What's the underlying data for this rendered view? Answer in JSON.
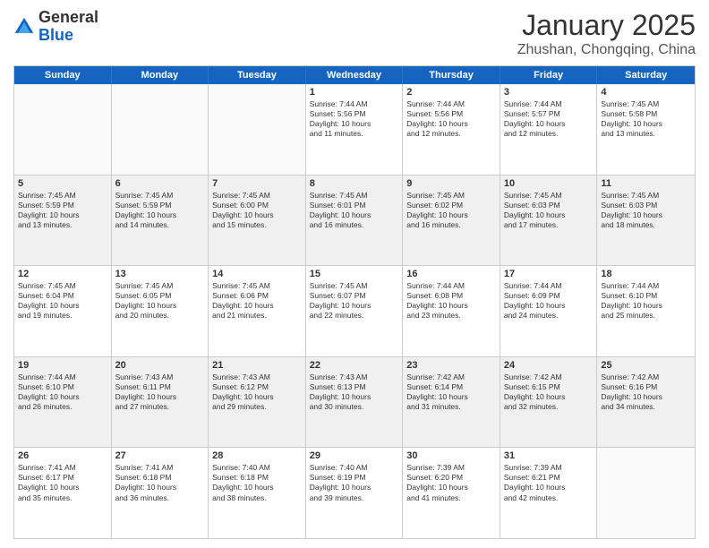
{
  "logo": {
    "general": "General",
    "blue": "Blue"
  },
  "header": {
    "title": "January 2025",
    "subtitle": "Zhushan, Chongqing, China"
  },
  "weekdays": [
    "Sunday",
    "Monday",
    "Tuesday",
    "Wednesday",
    "Thursday",
    "Friday",
    "Saturday"
  ],
  "weeks": [
    [
      {
        "day": "",
        "lines": []
      },
      {
        "day": "",
        "lines": []
      },
      {
        "day": "",
        "lines": []
      },
      {
        "day": "1",
        "lines": [
          "Sunrise: 7:44 AM",
          "Sunset: 5:56 PM",
          "Daylight: 10 hours",
          "and 11 minutes."
        ]
      },
      {
        "day": "2",
        "lines": [
          "Sunrise: 7:44 AM",
          "Sunset: 5:56 PM",
          "Daylight: 10 hours",
          "and 12 minutes."
        ]
      },
      {
        "day": "3",
        "lines": [
          "Sunrise: 7:44 AM",
          "Sunset: 5:57 PM",
          "Daylight: 10 hours",
          "and 12 minutes."
        ]
      },
      {
        "day": "4",
        "lines": [
          "Sunrise: 7:45 AM",
          "Sunset: 5:58 PM",
          "Daylight: 10 hours",
          "and 13 minutes."
        ]
      }
    ],
    [
      {
        "day": "5",
        "lines": [
          "Sunrise: 7:45 AM",
          "Sunset: 5:59 PM",
          "Daylight: 10 hours",
          "and 13 minutes."
        ]
      },
      {
        "day": "6",
        "lines": [
          "Sunrise: 7:45 AM",
          "Sunset: 5:59 PM",
          "Daylight: 10 hours",
          "and 14 minutes."
        ]
      },
      {
        "day": "7",
        "lines": [
          "Sunrise: 7:45 AM",
          "Sunset: 6:00 PM",
          "Daylight: 10 hours",
          "and 15 minutes."
        ]
      },
      {
        "day": "8",
        "lines": [
          "Sunrise: 7:45 AM",
          "Sunset: 6:01 PM",
          "Daylight: 10 hours",
          "and 16 minutes."
        ]
      },
      {
        "day": "9",
        "lines": [
          "Sunrise: 7:45 AM",
          "Sunset: 6:02 PM",
          "Daylight: 10 hours",
          "and 16 minutes."
        ]
      },
      {
        "day": "10",
        "lines": [
          "Sunrise: 7:45 AM",
          "Sunset: 6:03 PM",
          "Daylight: 10 hours",
          "and 17 minutes."
        ]
      },
      {
        "day": "11",
        "lines": [
          "Sunrise: 7:45 AM",
          "Sunset: 6:03 PM",
          "Daylight: 10 hours",
          "and 18 minutes."
        ]
      }
    ],
    [
      {
        "day": "12",
        "lines": [
          "Sunrise: 7:45 AM",
          "Sunset: 6:04 PM",
          "Daylight: 10 hours",
          "and 19 minutes."
        ]
      },
      {
        "day": "13",
        "lines": [
          "Sunrise: 7:45 AM",
          "Sunset: 6:05 PM",
          "Daylight: 10 hours",
          "and 20 minutes."
        ]
      },
      {
        "day": "14",
        "lines": [
          "Sunrise: 7:45 AM",
          "Sunset: 6:06 PM",
          "Daylight: 10 hours",
          "and 21 minutes."
        ]
      },
      {
        "day": "15",
        "lines": [
          "Sunrise: 7:45 AM",
          "Sunset: 6:07 PM",
          "Daylight: 10 hours",
          "and 22 minutes."
        ]
      },
      {
        "day": "16",
        "lines": [
          "Sunrise: 7:44 AM",
          "Sunset: 6:08 PM",
          "Daylight: 10 hours",
          "and 23 minutes."
        ]
      },
      {
        "day": "17",
        "lines": [
          "Sunrise: 7:44 AM",
          "Sunset: 6:09 PM",
          "Daylight: 10 hours",
          "and 24 minutes."
        ]
      },
      {
        "day": "18",
        "lines": [
          "Sunrise: 7:44 AM",
          "Sunset: 6:10 PM",
          "Daylight: 10 hours",
          "and 25 minutes."
        ]
      }
    ],
    [
      {
        "day": "19",
        "lines": [
          "Sunrise: 7:44 AM",
          "Sunset: 6:10 PM",
          "Daylight: 10 hours",
          "and 26 minutes."
        ]
      },
      {
        "day": "20",
        "lines": [
          "Sunrise: 7:43 AM",
          "Sunset: 6:11 PM",
          "Daylight: 10 hours",
          "and 27 minutes."
        ]
      },
      {
        "day": "21",
        "lines": [
          "Sunrise: 7:43 AM",
          "Sunset: 6:12 PM",
          "Daylight: 10 hours",
          "and 29 minutes."
        ]
      },
      {
        "day": "22",
        "lines": [
          "Sunrise: 7:43 AM",
          "Sunset: 6:13 PM",
          "Daylight: 10 hours",
          "and 30 minutes."
        ]
      },
      {
        "day": "23",
        "lines": [
          "Sunrise: 7:42 AM",
          "Sunset: 6:14 PM",
          "Daylight: 10 hours",
          "and 31 minutes."
        ]
      },
      {
        "day": "24",
        "lines": [
          "Sunrise: 7:42 AM",
          "Sunset: 6:15 PM",
          "Daylight: 10 hours",
          "and 32 minutes."
        ]
      },
      {
        "day": "25",
        "lines": [
          "Sunrise: 7:42 AM",
          "Sunset: 6:16 PM",
          "Daylight: 10 hours",
          "and 34 minutes."
        ]
      }
    ],
    [
      {
        "day": "26",
        "lines": [
          "Sunrise: 7:41 AM",
          "Sunset: 6:17 PM",
          "Daylight: 10 hours",
          "and 35 minutes."
        ]
      },
      {
        "day": "27",
        "lines": [
          "Sunrise: 7:41 AM",
          "Sunset: 6:18 PM",
          "Daylight: 10 hours",
          "and 36 minutes."
        ]
      },
      {
        "day": "28",
        "lines": [
          "Sunrise: 7:40 AM",
          "Sunset: 6:18 PM",
          "Daylight: 10 hours",
          "and 38 minutes."
        ]
      },
      {
        "day": "29",
        "lines": [
          "Sunrise: 7:40 AM",
          "Sunset: 6:19 PM",
          "Daylight: 10 hours",
          "and 39 minutes."
        ]
      },
      {
        "day": "30",
        "lines": [
          "Sunrise: 7:39 AM",
          "Sunset: 6:20 PM",
          "Daylight: 10 hours",
          "and 41 minutes."
        ]
      },
      {
        "day": "31",
        "lines": [
          "Sunrise: 7:39 AM",
          "Sunset: 6:21 PM",
          "Daylight: 10 hours",
          "and 42 minutes."
        ]
      },
      {
        "day": "",
        "lines": []
      }
    ]
  ]
}
